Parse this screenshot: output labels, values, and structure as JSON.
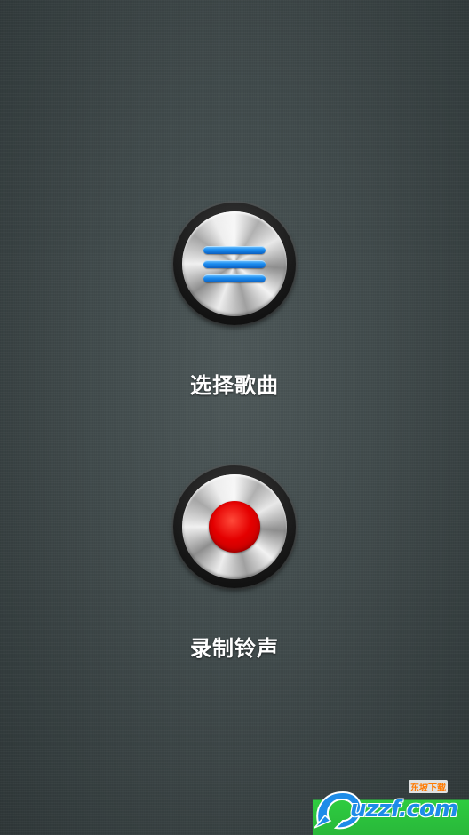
{
  "buttons": {
    "select_song": {
      "label": "选择歌曲",
      "icon": "menu-icon",
      "icon_color": "#1a8cf0"
    },
    "record_ringtone": {
      "label": "录制铃声",
      "icon": "record-icon",
      "icon_color": "#e40000"
    }
  },
  "watermark": {
    "brand": "uzzf.com",
    "tagline": "东坡下载"
  },
  "colors": {
    "background": "#414b4c",
    "label_text": "#ffffff"
  }
}
